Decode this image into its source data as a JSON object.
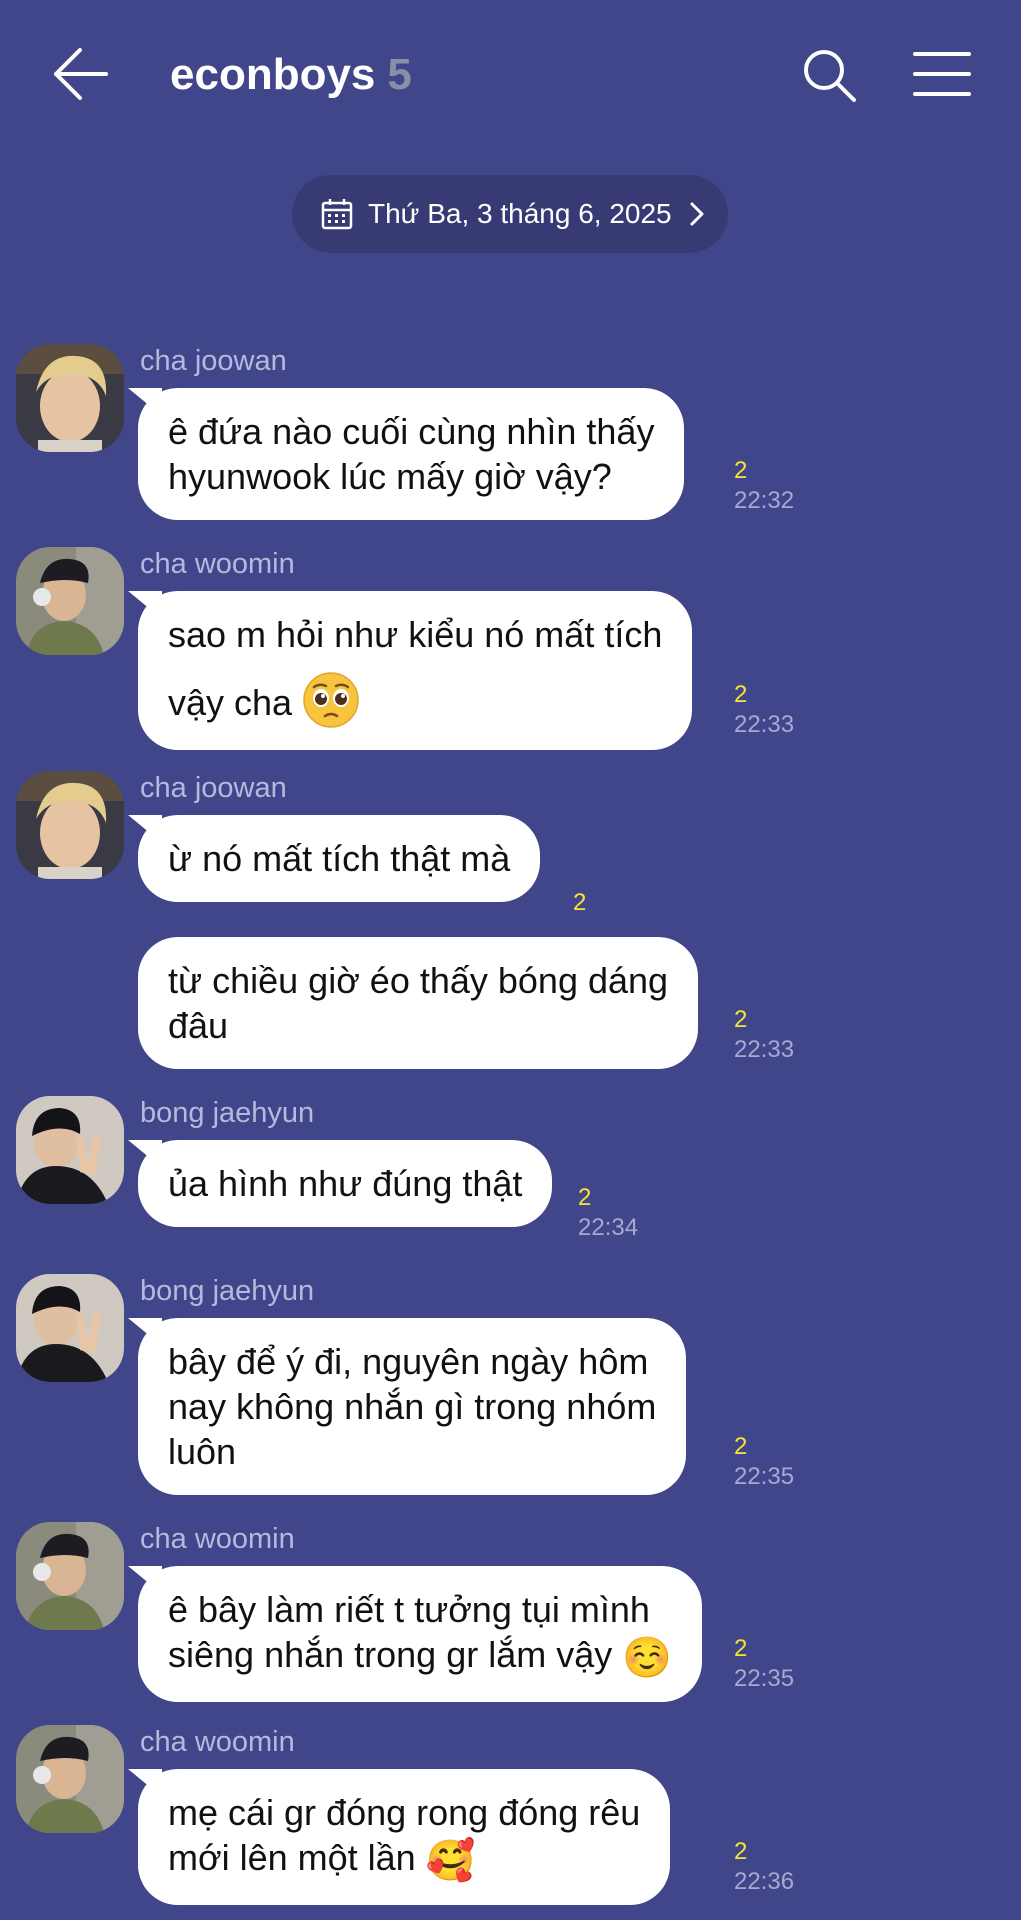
{
  "header": {
    "title": "econboys",
    "member_count": "5",
    "icons": [
      "back-arrow-icon",
      "search-icon",
      "menu-icon"
    ]
  },
  "date_divider": {
    "label": "Thứ Ba, 3 tháng 6, 2025",
    "icon": "calendar-icon"
  },
  "colors": {
    "background": "#41458a",
    "bubble": "#ffffff",
    "unread": "#f3e437",
    "time": "#a7a9d2",
    "sender": "#b6b8dd"
  },
  "messages": [
    {
      "sender": "cha joowan",
      "lines": [
        "ê đứa nào cuối cùng nhìn thấy",
        "hyunwook lúc mấy giờ vậy?"
      ],
      "unread": "2",
      "time": "22:32"
    },
    {
      "sender": "cha woomin",
      "lines": [
        "sao m hỏi như kiểu nó mất tích",
        "vậy cha"
      ],
      "emoji": "🥺",
      "unread": "2",
      "time": "22:33"
    },
    {
      "sender": "cha joowan",
      "lines": [
        "ừ nó mất tích thật mà"
      ],
      "unread": "2",
      "time": ""
    },
    {
      "sender": "",
      "lines": [
        "từ chiều giờ éo thấy bóng dáng",
        "đâu"
      ],
      "unread": "2",
      "time": "22:33"
    },
    {
      "sender": "bong jaehyun",
      "lines": [
        "ủa hình như đúng thật"
      ],
      "unread": "2",
      "time": "22:34"
    },
    {
      "sender": "bong jaehyun",
      "lines": [
        "bây để ý đi, nguyên ngày hôm",
        "nay không nhắn gì trong nhóm",
        "luôn"
      ],
      "unread": "2",
      "time": "22:35"
    },
    {
      "sender": "cha woomin",
      "lines": [
        "ê bây làm riết t tưởng tụi mình",
        "siêng nhắn trong gr lắm vậy"
      ],
      "emoji": "☺️",
      "unread": "2",
      "time": "22:35"
    },
    {
      "sender": "cha woomin",
      "lines": [
        "mẹ cái gr đóng rong đóng rêu",
        "mới lên một lần"
      ],
      "emoji": "🥰",
      "unread": "2",
      "time": "22:36"
    }
  ]
}
